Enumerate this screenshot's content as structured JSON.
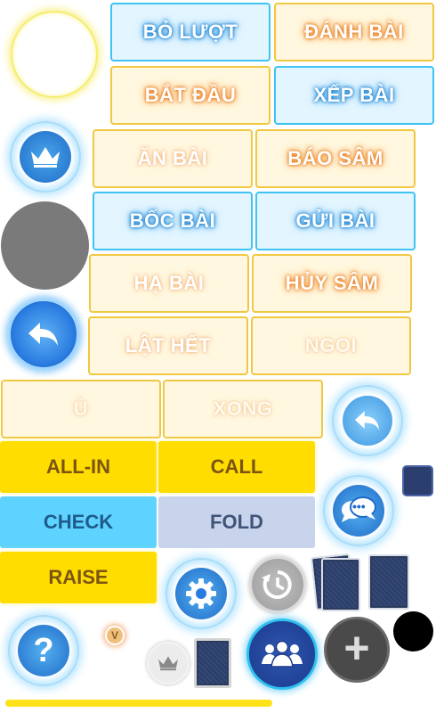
{
  "game_buttons": {
    "bo_luot": "BỎ LƯỢT",
    "danh_bai": "ĐÁNH BÀI",
    "bat_dau": "BẮT ĐẦU",
    "xep_bai": "XẾP BÀI",
    "an_bai": "ĂN BÀI",
    "bao_sam": "BÁO SÂM",
    "boc_bai": "BỐC BÀI",
    "gui_bai": "GỬI BÀI",
    "ha_bai": "HẠ BÀI",
    "huy_sam": "HỦY SÂM",
    "lat_het": "LẬT HẾT",
    "ngoi": "NGOI",
    "u": "Ù",
    "xong": "XONG"
  },
  "poker_buttons": {
    "all_in": "ALL-IN",
    "call": "CALL",
    "check": "CHECK",
    "fold": "FOLD",
    "raise": "RAISE"
  },
  "icons": {
    "chat_dots": "•••",
    "help": "?",
    "vip_badge": "V",
    "plus": "+"
  },
  "colors": {
    "accent_blue": "#3ec3f2",
    "accent_gold": "#f1c842",
    "poker_yellow": "#ffdd00",
    "poker_cyan": "#5fd3ff",
    "poker_grey": "#c8d3ec",
    "navy": "#1f3c8c"
  }
}
